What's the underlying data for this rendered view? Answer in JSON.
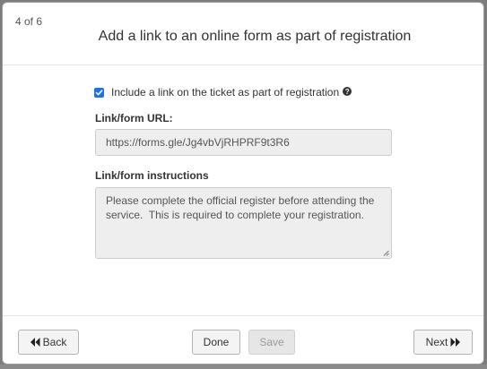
{
  "dialog": {
    "step": "4 of 6",
    "title": "Add a link to an online form as part of registration"
  },
  "form": {
    "include_link_checked": true,
    "include_link_label": "Include a link on the ticket as part of registration",
    "url_label": "Link/form URL:",
    "url_value": "https://forms.gle/Jg4vbVjRHPRF9t3R6",
    "instructions_label": "Link/form instructions",
    "instructions_value": "Please complete the official register before attending the service.  This is required to complete your registration."
  },
  "footer": {
    "back_label": "Back",
    "done_label": "Done",
    "save_label": "Save",
    "next_label": "Next"
  },
  "colors": {
    "checkbox_accent": "#1a73e8",
    "input_background": "#eeeeee"
  },
  "icons": {
    "help": "question-circle-icon",
    "back": "double-chevron-left-icon",
    "next": "double-chevron-right-icon",
    "checkmark": "checkmark-icon"
  }
}
